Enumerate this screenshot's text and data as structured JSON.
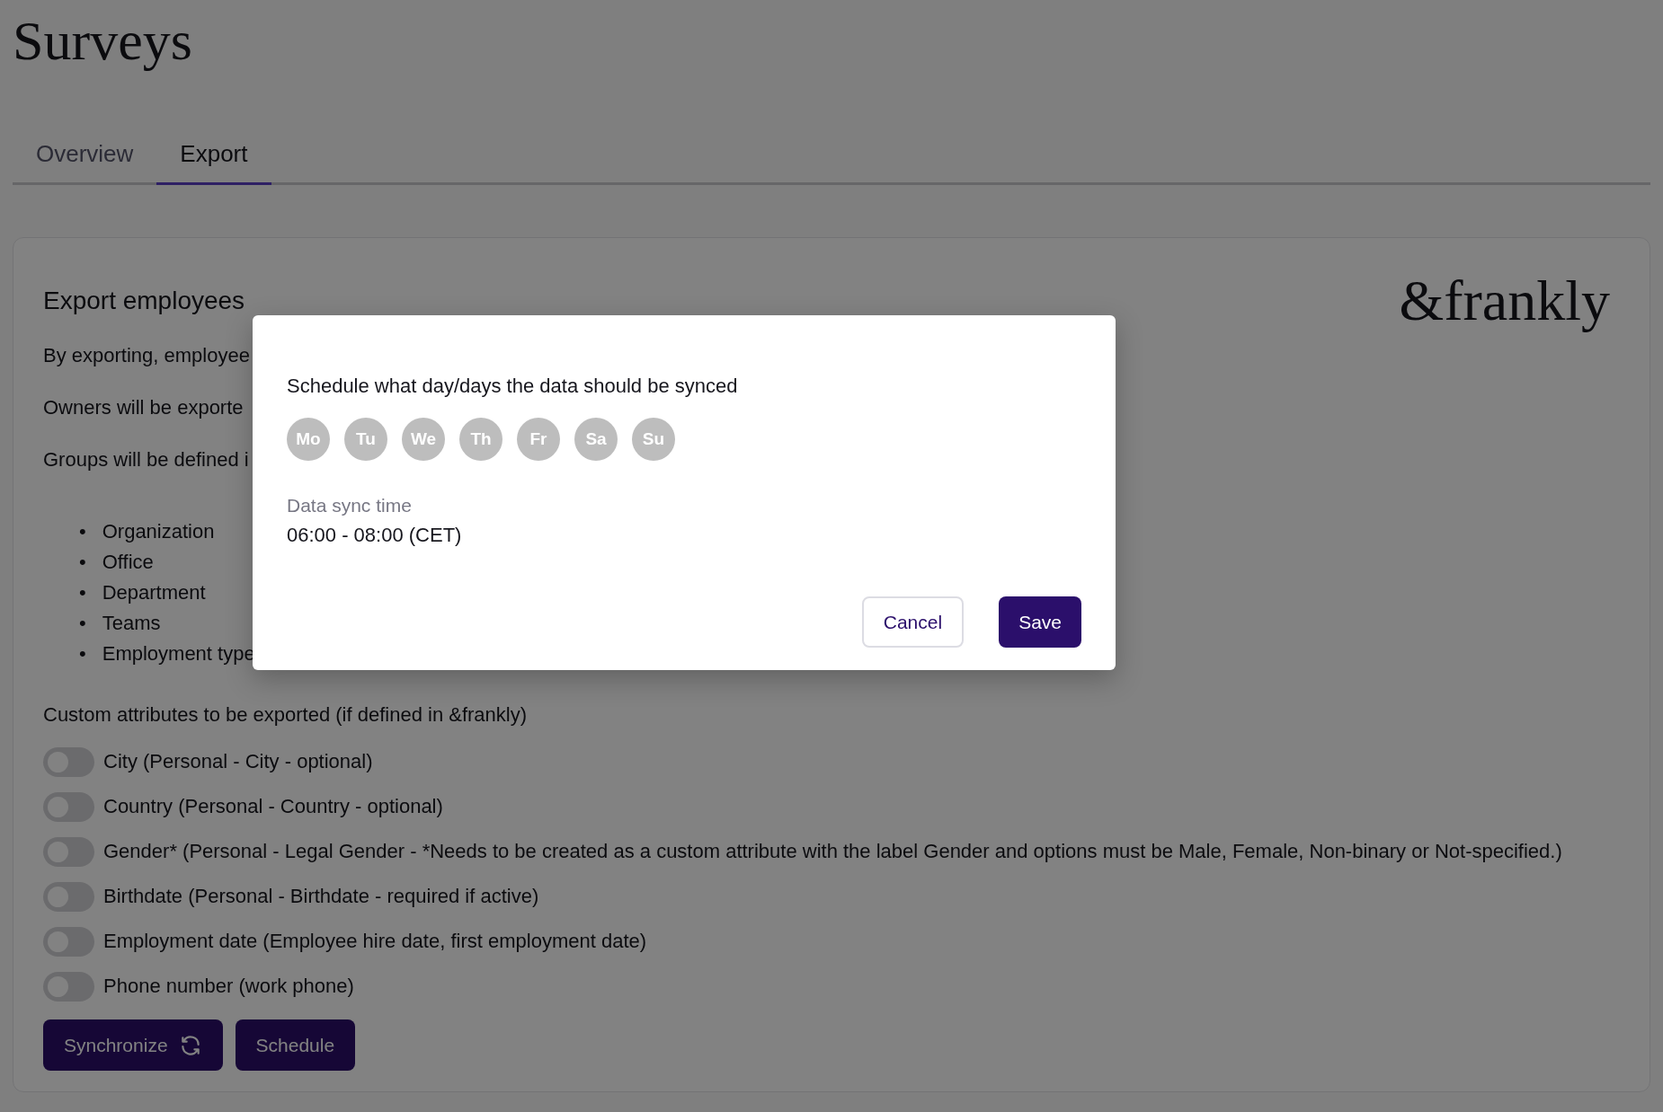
{
  "page": {
    "title": "Surveys"
  },
  "tabs": [
    {
      "label": "Overview",
      "selected": false
    },
    {
      "label": "Export",
      "selected": true
    }
  ],
  "export_card": {
    "heading": "Export employees",
    "logo": "&frankly",
    "paragraphs": [
      "By exporting, employee",
      "Owners will be exporte",
      "Groups will be defined i"
    ],
    "group_items": [
      {
        "marker": "•",
        "text": "Organization"
      },
      {
        "marker": "•",
        "text": "Office"
      },
      {
        "marker": "•",
        "text": "Department"
      },
      {
        "marker": "•",
        "text": "Teams"
      },
      {
        "marker": "•",
        "text": "Employment type"
      }
    ],
    "custom_heading": "Custom attributes to be exported (if defined in &frankly)",
    "attributes": [
      {
        "label": "City (Personal - City - optional)",
        "on": false
      },
      {
        "label": "Country (Personal - Country - optional)",
        "on": false
      },
      {
        "label": "Gender* (Personal - Legal Gender - *Needs to be created as a custom attribute with the label Gender and options must be Male, Female, Non-binary or Not-specified.)",
        "on": false
      },
      {
        "label": "Birthdate (Personal - Birthdate - required if active)",
        "on": false
      },
      {
        "label": "Employment date (Employee hire date, first employment date)",
        "on": false
      },
      {
        "label": "Phone number (work phone)",
        "on": false
      }
    ],
    "buttons": [
      {
        "label": "Synchronize",
        "kind": "sync"
      },
      {
        "label": "Schedule",
        "kind": "plain"
      }
    ]
  },
  "dialog": {
    "prompt": "Schedule what day/days the data should be synced",
    "days": [
      {
        "label": "Mo",
        "selected": false
      },
      {
        "label": "Tu",
        "selected": false
      },
      {
        "label": "We",
        "selected": false
      },
      {
        "label": "Th",
        "selected": false
      },
      {
        "label": "Fr",
        "selected": false
      },
      {
        "label": "Sa",
        "selected": false
      },
      {
        "label": "Su",
        "selected": false
      }
    ],
    "time_label": "Data sync time",
    "time_value": "06:00 - 08:00 (CET)",
    "cancel": "Cancel",
    "save": "Save"
  }
}
